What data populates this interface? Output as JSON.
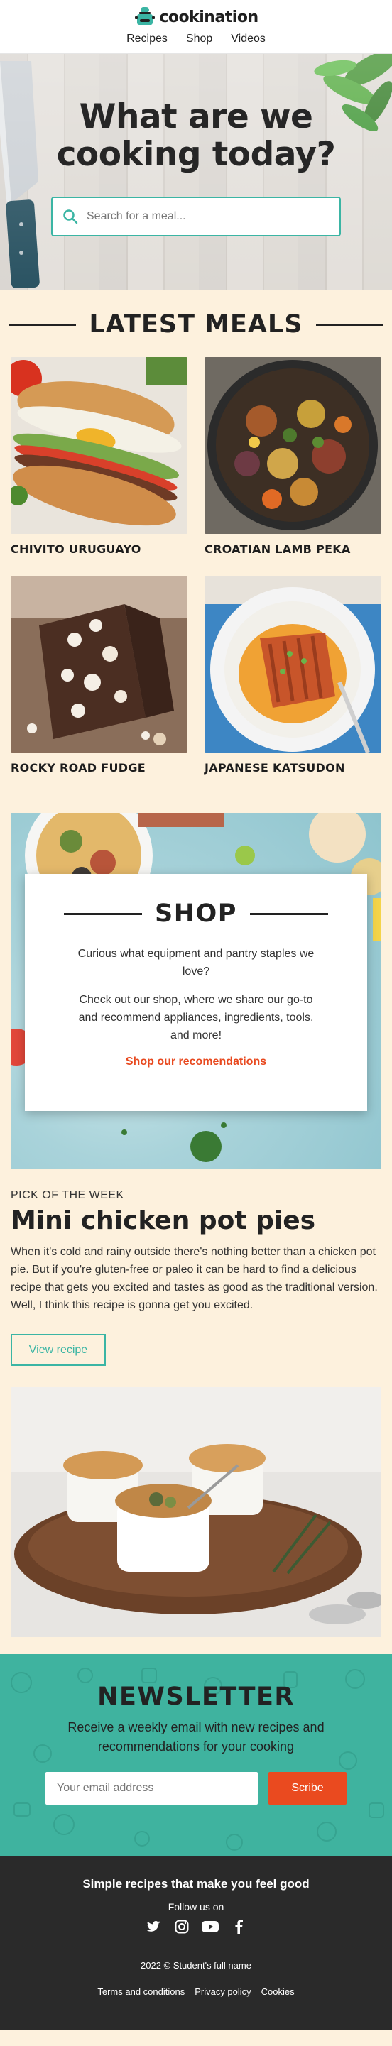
{
  "brand": {
    "name": "cookination"
  },
  "nav": {
    "items": [
      "Recipes",
      "Shop",
      "Videos"
    ]
  },
  "hero": {
    "title_line1": "What are we",
    "title_line2": "cooking today?",
    "search_placeholder": "Search for a meal..."
  },
  "latest": {
    "heading": "LATEST MEALS",
    "meals": [
      {
        "name": "CHIVITO URUGUAYO"
      },
      {
        "name": "CROATIAN LAMB PEKA"
      },
      {
        "name": "ROCKY ROAD FUDGE"
      },
      {
        "name": "JAPANESE KATSUDON"
      }
    ]
  },
  "shop": {
    "heading": "SHOP",
    "text1": "Curious what equipment and pantry staples we love?",
    "text2": "Check out our shop, where we share our go-to and recommend appliances, ingredients, tools, and more!",
    "link": "Shop our recomendations"
  },
  "pick": {
    "kicker": "PICK OF THE WEEK",
    "title": "Mini chicken pot pies",
    "description": "When it's cold and rainy outside there's nothing better than a chicken pot pie. But if you're gluten-free or paleo it can be hard to find a delicious recipe that gets you excited and tastes as good as the traditional version. Well, I think this recipe is gonna get you excited.",
    "button": "View recipe"
  },
  "newsletter": {
    "heading": "NEWSLETTER",
    "text": "Receive a weekly email with new recipes and recommendations for your cooking",
    "email_placeholder": "Your email address",
    "button": "Scribe"
  },
  "footer": {
    "tagline": "Simple recipes that make you feel good",
    "follow": "Follow us on",
    "socials": [
      "twitter-icon",
      "instagram-icon",
      "youtube-icon",
      "facebook-icon"
    ],
    "copyright": "2022 © Student's full name",
    "links": [
      "Terms and conditions",
      "Privacy policy",
      "Cookies"
    ]
  },
  "colors": {
    "accent": "#3bb5a4",
    "cta": "#ea4a1f",
    "background": "#fdf1dd",
    "footer": "#2a2a2a"
  }
}
